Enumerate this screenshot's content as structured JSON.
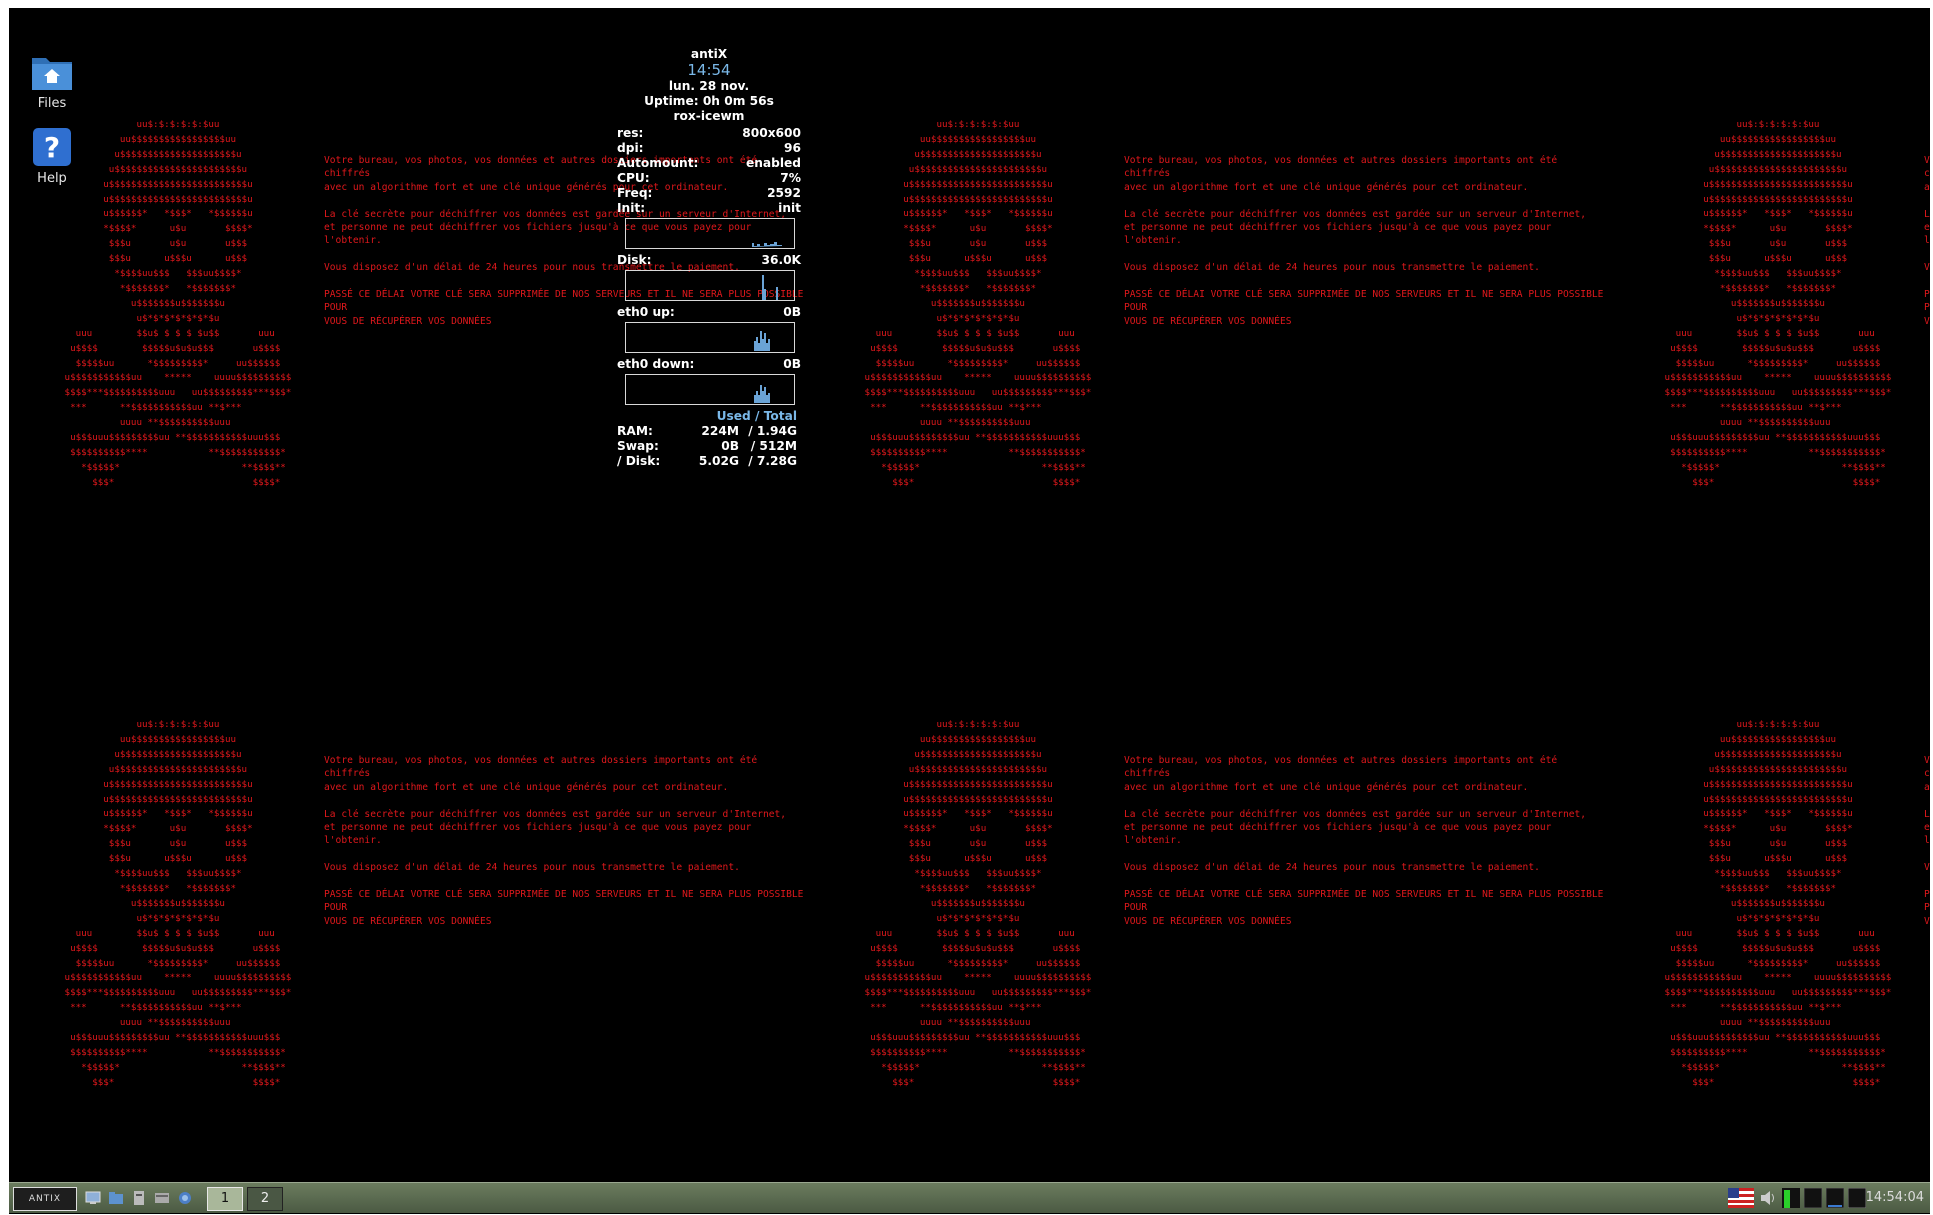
{
  "wallpaper": {
    "skull_ascii": "              uu$:$:$:$:$:$uu\n           uu$$$$$$$$$$$$$$$$$uu\n          u$$$$$$$$$$$$$$$$$$$$$u\n         u$$$$$$$$$$$$$$$$$$$$$$$u\n        u$$$$$$$$$$$$$$$$$$$$$$$$$u\n        u$$$$$$$$$$$$$$$$$$$$$$$$$u\n        u$$$$$$*   *$$$*   *$$$$$$u\n        *$$$$*      u$u       $$$$*\n         $$$u       u$u       u$$$\n         $$$u      u$$$u      u$$$\n          *$$$$uu$$$   $$$uu$$$$*\n           *$$$$$$$*   *$$$$$$$*\n             u$$$$$$$u$$$$$$$u\n              u$*$*$*$*$*$*$u\n   uuu        $$u$ $ $ $ $u$$       uuu\n  u$$$$        $$$$$u$u$u$$$       u$$$$\n   $$$$$uu      *$$$$$$$$$*     uu$$$$$$\n u$$$$$$$$$$$uu    *****    uuuu$$$$$$$$$$\n $$$$***$$$$$$$$$$uuu   uu$$$$$$$$$***$$$*\n  ***      **$$$$$$$$$$$uu **$***\n           uuuu **$$$$$$$$$$uuu\n  u$$$uuu$$$$$$$$$uu **$$$$$$$$$$$uuu$$$\n  $$$$$$$$$$****           **$$$$$$$$$$$*\n    *$$$$$*                      **$$$$**\n      $$$*                         $$$$*",
    "message": [
      "Votre bureau, vos photos, vos données et autres dossiers importants ont été chiffrés\navec un algorithme fort et une clé unique générés pour cet ordinateur.",
      "La clé secrète pour déchiffrer vos données est gardée sur un serveur d'Internet,\net personne ne peut déchiffrer vos fichiers jusqu'à ce que vous payez pour l'obtenir.",
      "Vous disposez d'un délai de 24 heures pour nous transmettre le paiement.",
      "PASSÉ CE DÉLAI VOTRE CLÉ SERA SUPPRIMÉE DE NOS SERVEURS ET IL NE SERA PLUS POSSIBLE POUR\nVOUS DE RÉCUPÉRER VOS DONNÉES"
    ],
    "text_color": "#e0181c"
  },
  "desktop_icons": [
    {
      "label": "Files",
      "icon": "home-folder-icon"
    },
    {
      "label": "Help",
      "icon": "question-mark-icon"
    }
  ],
  "conky": {
    "distro": "antiX",
    "time": "14:54",
    "date": "lun. 28 nov.",
    "uptime": "Uptime: 0h 0m 56s",
    "wm": "rox-icewm",
    "stats": [
      {
        "label": "res:",
        "value": "800x600"
      },
      {
        "label": "dpi:",
        "value": "96"
      },
      {
        "label": "Automount:",
        "value": "enabled"
      },
      {
        "label": "CPU:",
        "value": "7%"
      },
      {
        "label": "Freq:",
        "value": "2592"
      },
      {
        "label": "Init:",
        "value": "init"
      }
    ],
    "disk_label": "Disk:",
    "disk_value": "36.0K",
    "eth_up_label": "eth0 up:",
    "eth_up_value": "0B",
    "eth_down_label": "eth0 down:",
    "eth_down_value": "0B",
    "used_total_header": "Used / Total",
    "memory": [
      {
        "label": "RAM:",
        "used": "224M",
        "total": "/ 1.94G"
      },
      {
        "label": "Swap:",
        "used": "0B",
        "total": "/ 512M"
      },
      {
        "label": "/ Disk:",
        "used": "5.02G",
        "total": "/ 7.28G"
      }
    ],
    "accent_color": "#7ab8e8"
  },
  "taskbar": {
    "start_label": "ANTIX",
    "quick_launch": [
      "system-monitor-icon",
      "file-manager-icon",
      "terminal-icon",
      "editor-icon",
      "browser-icon"
    ],
    "workspaces": [
      "1",
      "2"
    ],
    "active_workspace": "1",
    "tray": [
      "us-flag-icon",
      "volume-icon",
      "cpu-meter-icon",
      "network-icon",
      "battery-icon"
    ],
    "clock": "14:54:04"
  }
}
